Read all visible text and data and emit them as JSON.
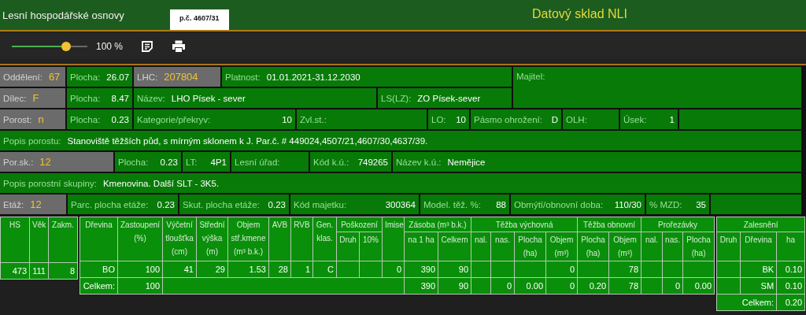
{
  "header": {
    "title": "Lesní hospodářské osnovy",
    "parcel_tag": "p.č. 4607/31",
    "app_name": "Datový sklad NLI"
  },
  "toolbar": {
    "zoom": {
      "level": 0.72
    },
    "zoom_reading": "100 %"
  },
  "form": {
    "block": {
      "lines": [
        {
          "fields": [
            {
              "kind": "key",
              "label": "Oddělení:",
              "value": "67"
            },
            {
              "kind": "field",
              "label": "Plocha:",
              "value": "26.07"
            },
            {
              "kind": "key",
              "label": "LHC:",
              "value": "207804"
            },
            {
              "kind": "text",
              "label": "Platnost:",
              "value": "01.01.2021-31.12.2030"
            }
          ]
        },
        {
          "fields": [
            {
              "kind": "key",
              "label": "Dílec:",
              "value": "F"
            },
            {
              "kind": "field",
              "label": "Plocha:",
              "value": "8.47"
            },
            {
              "kind": "text",
              "label": "Název:",
              "value": "LHO Písek - sever"
            },
            {
              "kind": "text",
              "label": "LS(LZ):",
              "value": "ZO Písek-sever"
            }
          ]
        }
      ],
      "side": {
        "kind": "text",
        "label": "Majitel:"
      }
    },
    "lines": [
      {
        "fields": [
          {
            "kind": "key",
            "label": "Porost:",
            "value": "n"
          },
          {
            "kind": "field",
            "label": "Plocha:",
            "value": "0.23"
          },
          {
            "kind": "field",
            "label": "Kategorie/překryv:",
            "value": "10"
          },
          {
            "kind": "text",
            "label": "Zvl.st.:"
          },
          {
            "kind": "field",
            "label": "LO:",
            "value": "10"
          },
          {
            "kind": "field",
            "label": "Pásmo ohrožení:",
            "value": "D"
          },
          {
            "kind": "text",
            "label": "OLH:"
          },
          {
            "kind": "field",
            "label": "Úsek:",
            "value": "1"
          },
          {
            "kind": "blank"
          }
        ]
      },
      {
        "fields": [
          {
            "kind": "text",
            "label": "Popis porostu:",
            "value": "Stanoviště těžších půd, s mírným sklonem k J. Par.č. # 449024,4507/21,4607/30,4637/39."
          }
        ]
      },
      {
        "fields": [
          {
            "kind": "key",
            "label": "Por.sk.:",
            "value": "12"
          },
          {
            "kind": "field",
            "label": "Plocha:",
            "value": "0.23"
          },
          {
            "kind": "field",
            "label": "LT:",
            "value": "4P1"
          },
          {
            "kind": "text",
            "label": "Lesní úřad:"
          },
          {
            "kind": "field",
            "label": "Kód k.ú.:",
            "value": "749265"
          },
          {
            "kind": "text",
            "label": "Název k.ú.:",
            "value": "Nemějice"
          }
        ]
      },
      {
        "fields": [
          {
            "kind": "text",
            "label": "Popis porostní skupiny:",
            "value": "Kmenovina. Další SLT - 3K5."
          }
        ]
      },
      {
        "fields": [
          {
            "kind": "key",
            "label": "Etáž:",
            "value": "12"
          },
          {
            "kind": "field",
            "label": "Parc. plocha etáže:",
            "value": "0.23"
          },
          {
            "kind": "field",
            "label": "Skut. plocha etáže:",
            "value": "0.23"
          },
          {
            "kind": "field",
            "label": "Kód majetku:",
            "value": "300364"
          },
          {
            "kind": "field",
            "label": "Model. těž. %:",
            "value": "88"
          },
          {
            "kind": "field",
            "label": "Obmýtí/obnovní doba:",
            "value": "110/30"
          },
          {
            "kind": "field",
            "label": "% MZD:",
            "value": "35"
          },
          {
            "kind": "blank"
          }
        ]
      }
    ]
  },
  "summary_table": {
    "columns": [
      "HS",
      "Věk",
      "Zakm."
    ],
    "rows": [
      [
        "473",
        "111",
        "8"
      ]
    ]
  },
  "species_table": {
    "header_rows": [
      [
        {
          "label": "Dřevina",
          "rowspan": 2
        },
        {
          "label": "Zastoupení\n(%)",
          "rowspan": 2
        },
        {
          "label": "Výčetní\ntloušťka\n(cm)",
          "rowspan": 2
        },
        {
          "label": "Střední\nvýška\n(m)",
          "rowspan": 2
        },
        {
          "label": "Objem\nstř.kmene\n(m³ b.k.)",
          "rowspan": 2
        },
        {
          "label": "AVB",
          "rowspan": 2
        },
        {
          "label": "RVB",
          "rowspan": 2
        },
        {
          "label": "Gen.\nklas.",
          "rowspan": 2
        },
        {
          "label": "Poškození",
          "colspan": 2
        },
        {
          "label": "Imise",
          "rowspan": 2
        },
        {
          "label": "Zásoba (m³ b.k.)",
          "colspan": 2
        },
        {
          "label": "Těžba výchovná",
          "colspan": 4
        },
        {
          "label": "Těžba obnovní",
          "colspan": 2
        },
        {
          "label": "Prořezávky",
          "colspan": 3
        }
      ],
      [
        {
          "label": "Druh"
        },
        {
          "label": "10%"
        },
        {
          "label": "na 1 ha"
        },
        {
          "label": "Celkem"
        },
        {
          "label": "nal."
        },
        {
          "label": "nas."
        },
        {
          "label": "Plocha\n(ha)"
        },
        {
          "label": "Objem\n(m³)"
        },
        {
          "label": "Plocha\n(ha)"
        },
        {
          "label": "Objem\n(m³)"
        },
        {
          "label": "nal."
        },
        {
          "label": "nas."
        },
        {
          "label": "Plocha\n(ha)"
        }
      ]
    ],
    "rows": [
      [
        {
          "text": "BO"
        },
        {
          "text": "100"
        },
        {
          "text": "41"
        },
        {
          "text": "29"
        },
        {
          "text": "1.53"
        },
        {
          "text": "28"
        },
        {
          "text": "1"
        },
        {
          "text": "C"
        },
        {},
        {},
        {
          "text": "0"
        },
        {
          "text": "390"
        },
        {
          "text": "90"
        },
        {},
        {},
        {},
        {
          "text": "0"
        },
        {},
        {
          "text": "78"
        },
        {},
        {},
        {}
      ],
      [
        {
          "text": "Celkem:"
        },
        {
          "text": "100"
        },
        {
          "colspan": 9
        },
        {
          "text": "390"
        },
        {
          "text": "90"
        },
        {},
        {
          "text": "0"
        },
        {
          "text": "0.00"
        },
        {
          "text": "0"
        },
        {
          "text": "0.20"
        },
        {
          "text": "78"
        },
        {},
        {
          "text": "0"
        },
        {
          "text": "0.00"
        }
      ]
    ]
  },
  "afforestation_table": {
    "header_rows": [
      [
        {
          "label": "Zalesnění",
          "colspan": 3
        }
      ],
      [
        {
          "label": "Druh"
        },
        {
          "label": "Dřevina"
        },
        {
          "label": "ha"
        }
      ]
    ],
    "rows": [
      [
        {},
        {
          "text": "BK"
        },
        {
          "text": "0.10"
        }
      ],
      [
        {},
        {
          "text": "SM"
        },
        {
          "text": "0.10"
        }
      ],
      [
        {
          "text": "Celkem:",
          "colspan": 2
        },
        {
          "text": "0.20"
        }
      ]
    ]
  }
}
